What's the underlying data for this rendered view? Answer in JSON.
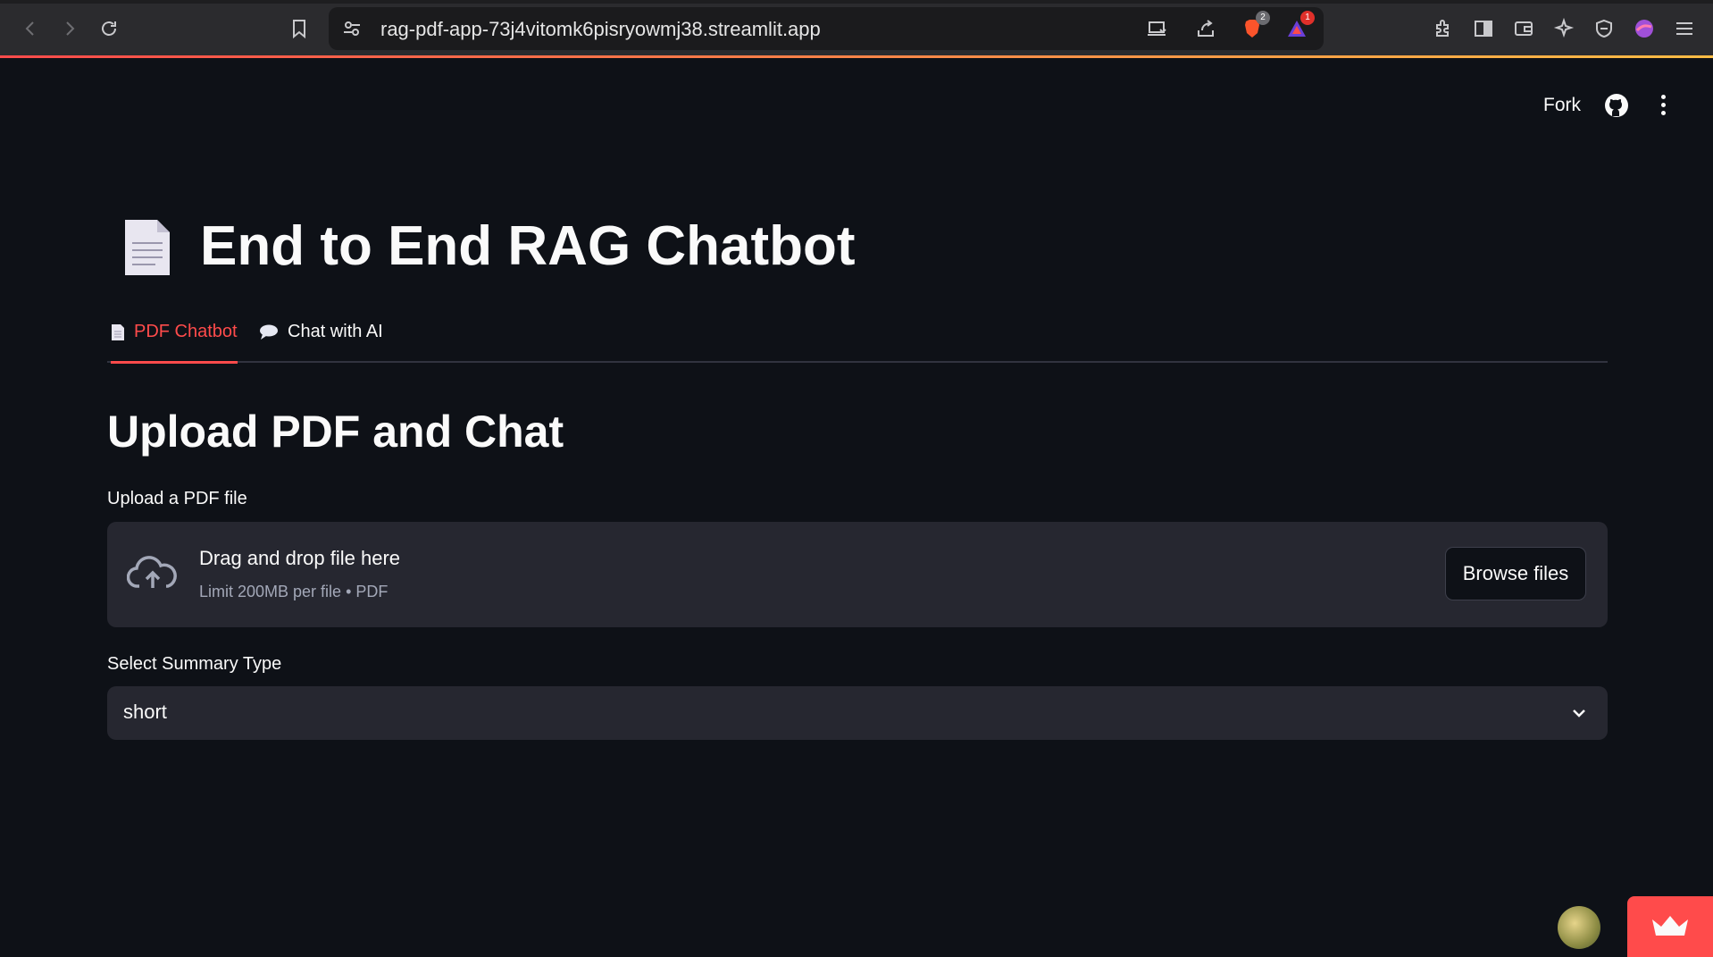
{
  "browser": {
    "url": "rag-pdf-app-73j4vitomk6pisryowmj38.streamlit.app",
    "brave_shield_count": "2",
    "rewards_count": "1"
  },
  "header": {
    "fork_label": "Fork"
  },
  "page": {
    "title_icon": "document-icon",
    "title": "End to End RAG Chatbot",
    "tabs": [
      {
        "label": "PDF Chatbot",
        "active": true,
        "icon": "document-icon"
      },
      {
        "label": "Chat with AI",
        "active": false,
        "icon": "speech-bubble-icon"
      }
    ],
    "section_heading": "Upload PDF and Chat",
    "upload": {
      "label": "Upload a PDF file",
      "drop_text": "Drag and drop file here",
      "limit_text": "Limit 200MB per file • PDF",
      "browse_label": "Browse files"
    },
    "summary": {
      "label": "Select Summary Type",
      "selected": "short"
    }
  },
  "colors": {
    "background": "#0e1117",
    "accent": "#ff4b4b",
    "widget": "#262730"
  }
}
